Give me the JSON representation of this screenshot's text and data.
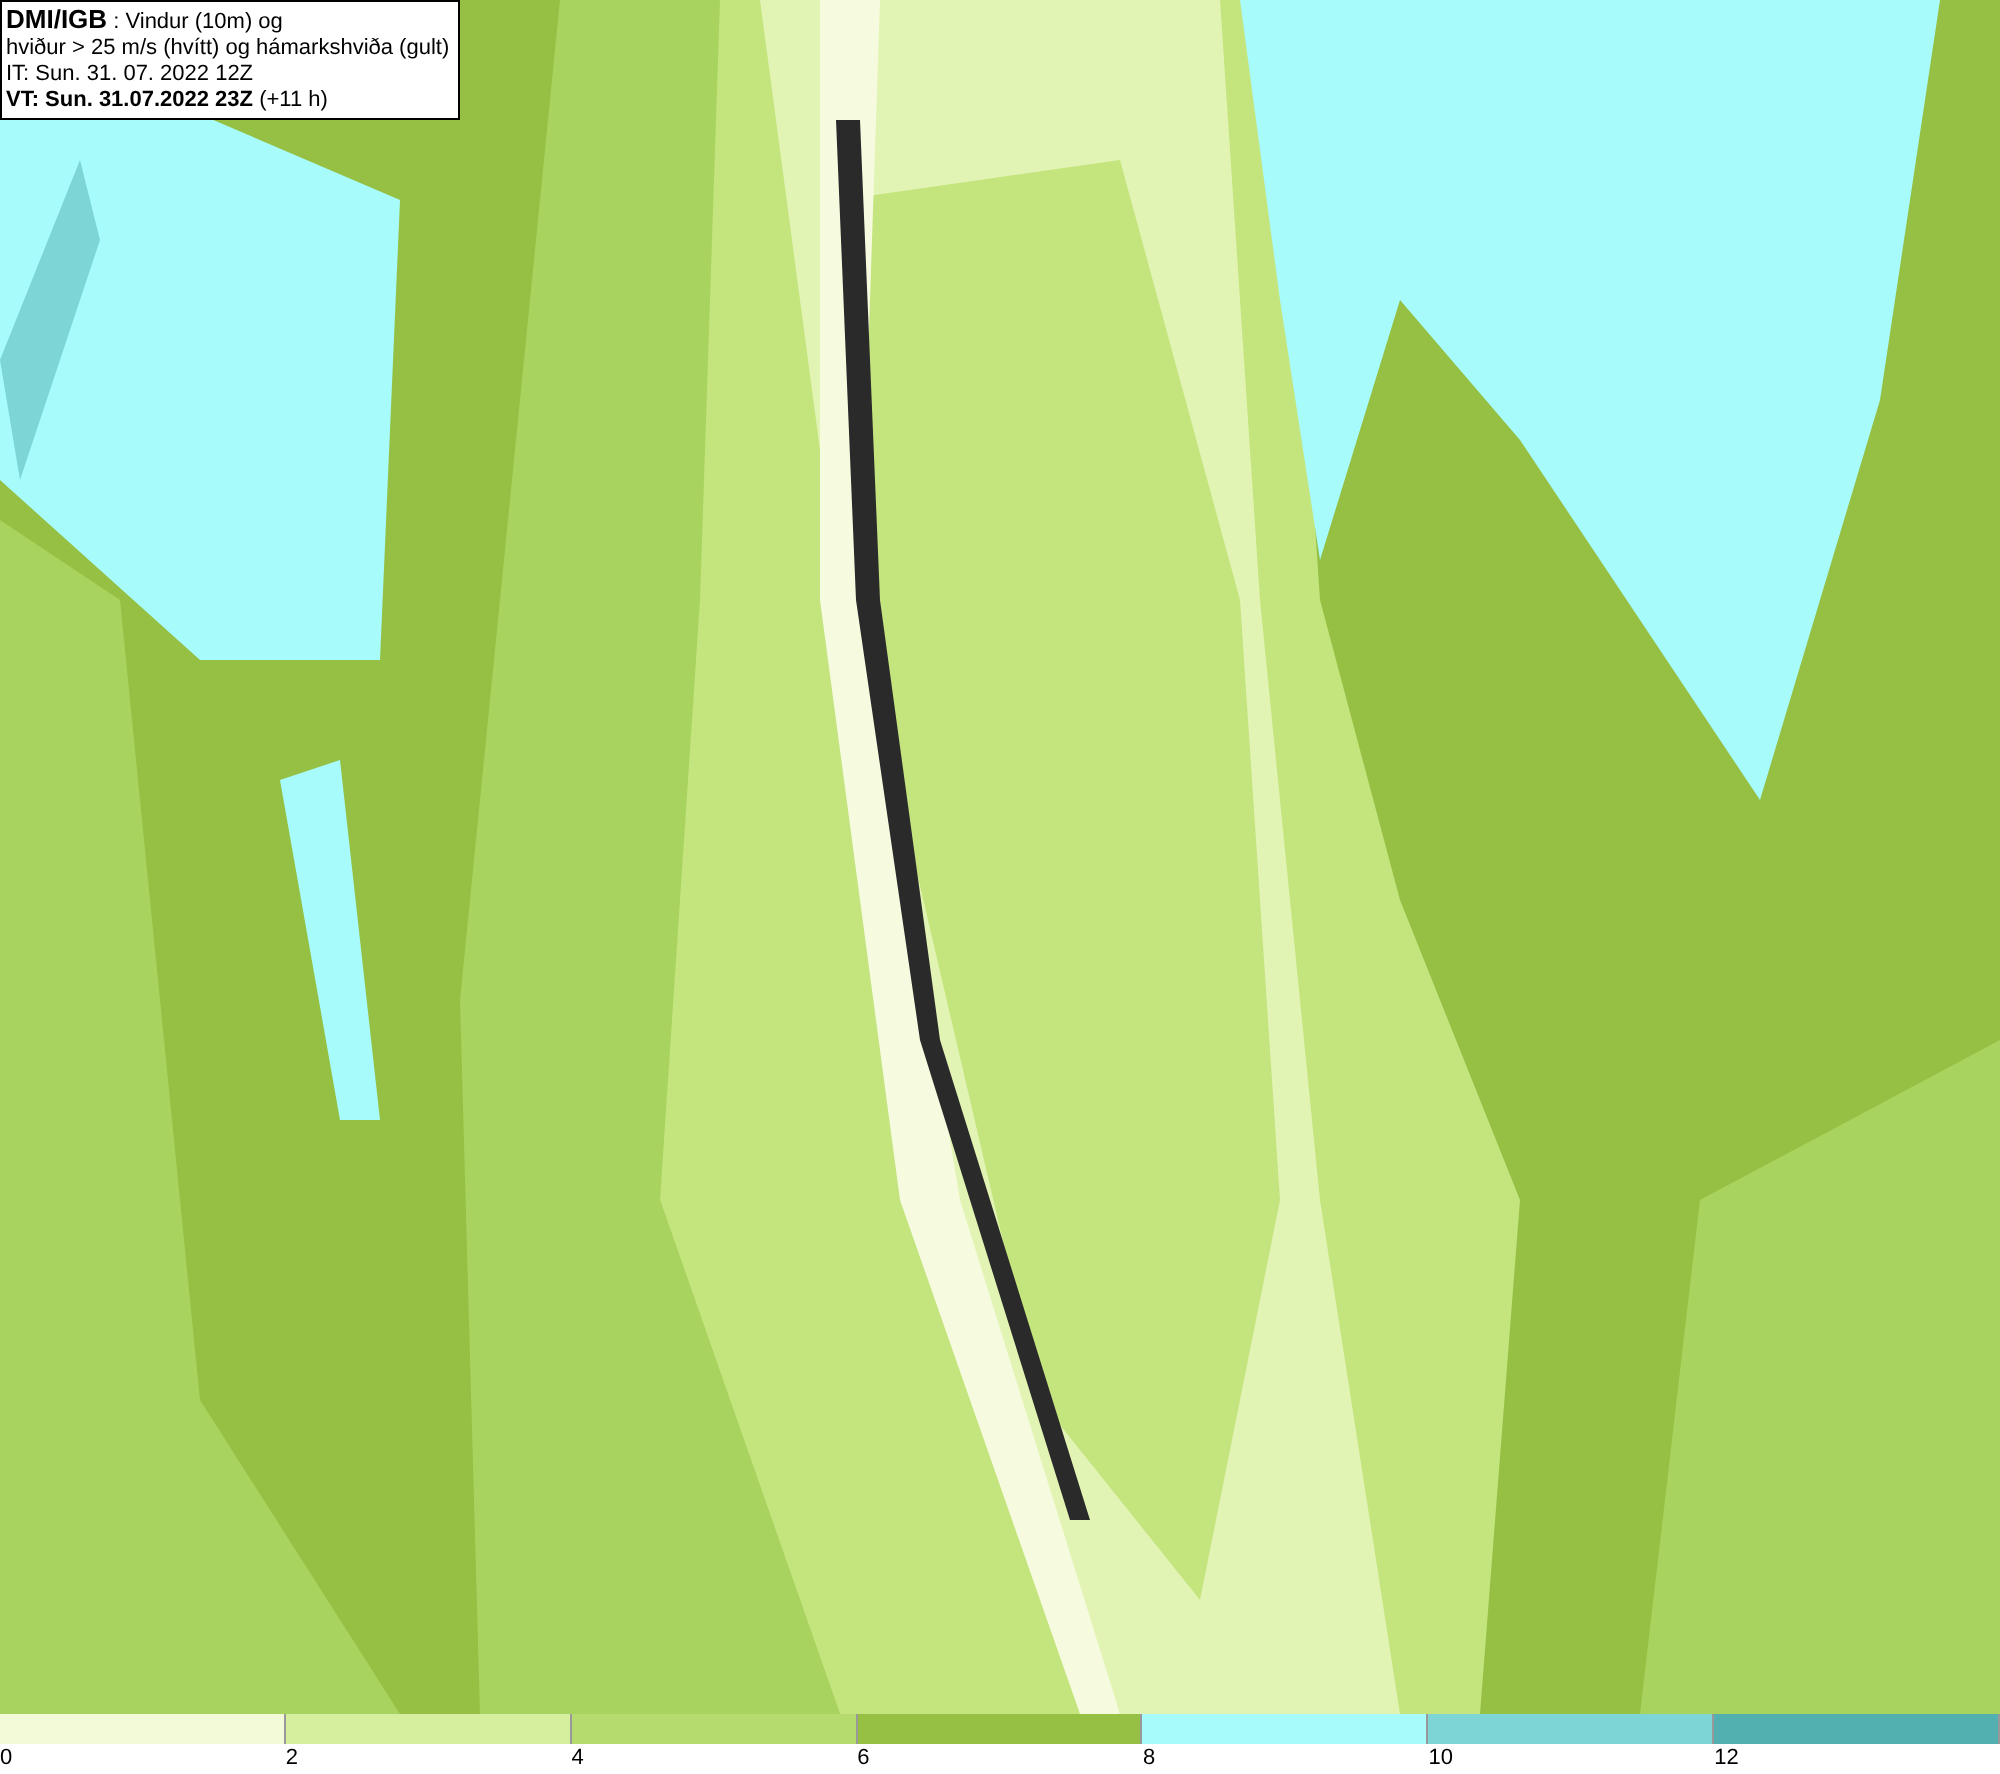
{
  "header": {
    "lines": [
      "**DMI/IGB** : Vindur (10m) og",
      "hviður > 25 m/s (hvítt) og hámarkshviða (gult)",
      "IT: Sun. 31. 07. 2022 12Z",
      "**VT: Sun. 31.07.2022 23Z** (+11 h)"
    ]
  },
  "legend": {
    "segments": [
      {
        "label": "0",
        "color": "#f2fad8"
      },
      {
        "label": "2",
        "color": "#d6ef9e"
      },
      {
        "label": "4",
        "color": "#b5db6e"
      },
      {
        "label": "6",
        "color": "#95c044"
      },
      {
        "label": "8",
        "color": "#a8fbfb"
      },
      {
        "label": "10",
        "color": "#7dd5d5"
      },
      {
        "label": "12",
        "color": "#52b0b0"
      }
    ]
  }
}
